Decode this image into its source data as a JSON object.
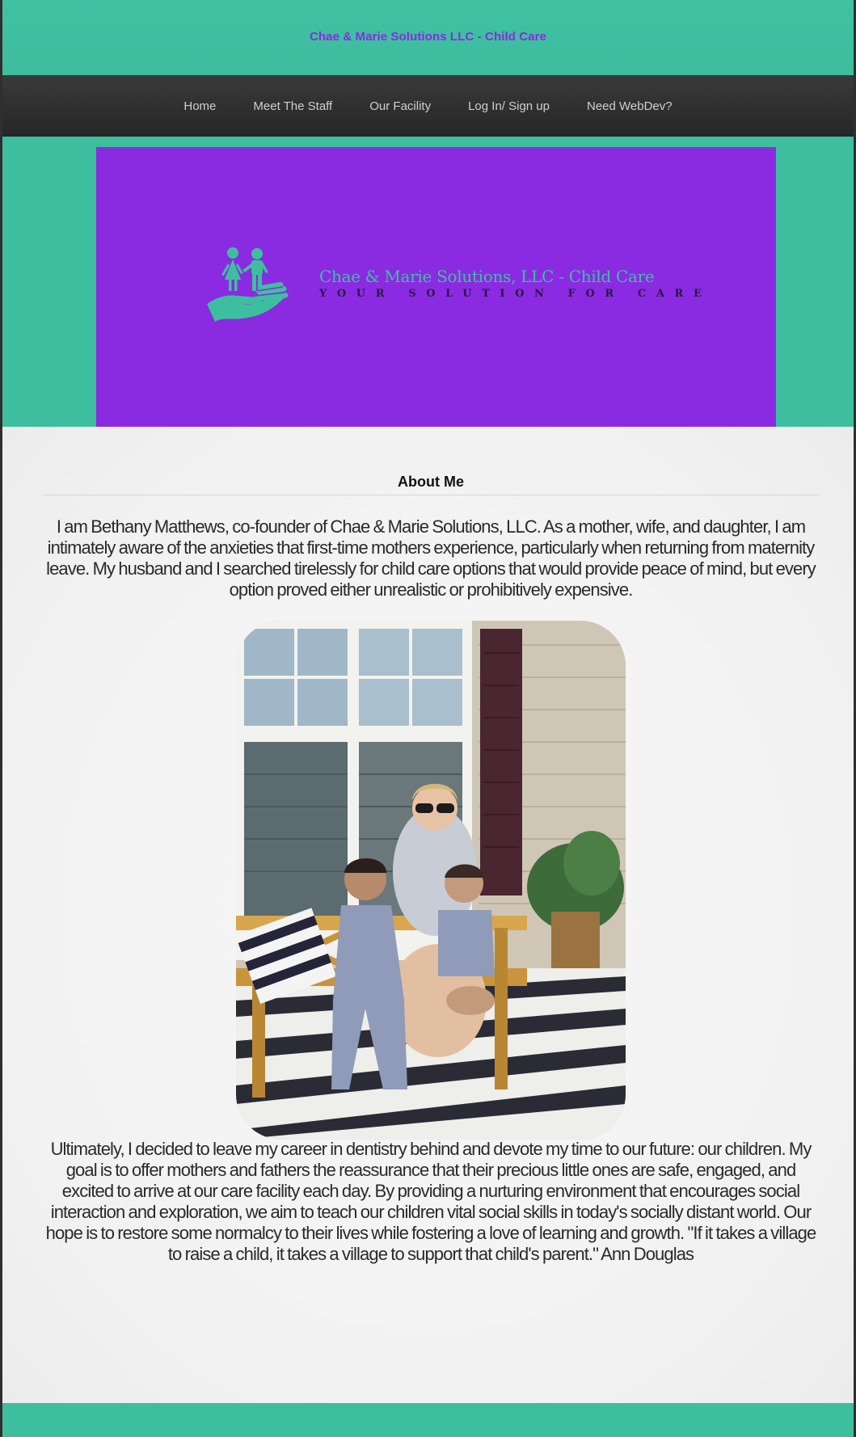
{
  "header": {
    "site_title": "Chae & Marie Solutions LLC - Child Care"
  },
  "nav": {
    "items": [
      {
        "label": "Home"
      },
      {
        "label": "Meet The Staff"
      },
      {
        "label": "Our Facility"
      },
      {
        "label": "Log In/ Sign up"
      },
      {
        "label": "Need WebDev?"
      }
    ]
  },
  "banner": {
    "logo_name": "Chae & Marie Solutions, LLC - Child Care",
    "logo_tagline": "YOUR SOLUTION FOR CARE",
    "icon": "family-hand-icon"
  },
  "about": {
    "heading": "About Me",
    "paragraph_1": "I am Bethany Matthews, co-founder of Chae & Marie Solutions, LLC. As a mother, wife, and daughter, I am intimately aware of the anxieties that first-time mothers experience, particularly when returning from maternity leave. My husband and I searched tirelessly for child care options that would provide peace of mind, but every option proved either unrealistic or prohibitively expensive.",
    "paragraph_2": "Ultimately, I decided to leave my career in dentistry behind and devote my time to our future: our children. My goal is to offer mothers and fathers the reassurance that their precious little ones are safe, engaged, and excited to arrive at our care facility each day. By providing a nurturing environment that encourages social interaction and exploration, we aim to teach our children vital social skills in today's socially distant world. Our hope is to restore some normalcy to their lives while fostering a love of learning and growth. \"If it takes a village to raise a child, it takes a village to support that child's parent.\" Ann Douglas"
  },
  "colors": {
    "teal": "#3dbf9f",
    "purple": "#8a2be2",
    "nav_dark": "#2b2b2b"
  }
}
